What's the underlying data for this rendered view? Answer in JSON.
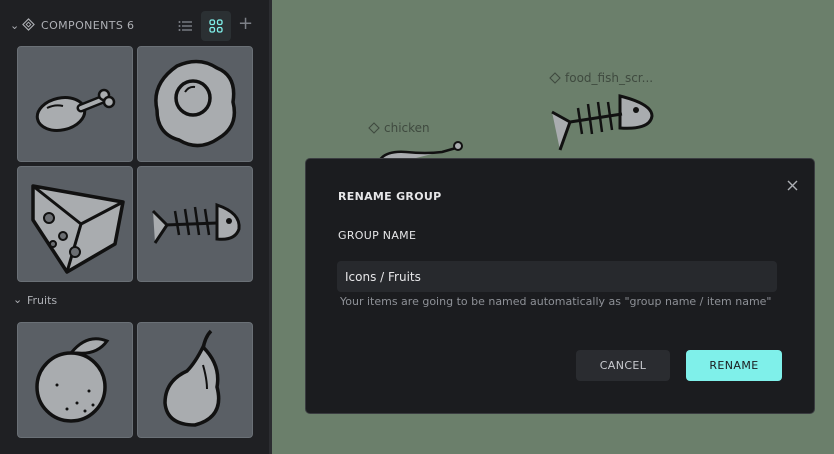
{
  "sidebar": {
    "title": "COMPONENTS",
    "count": "6",
    "group_name": "Fruits",
    "thumbnails": [
      "chicken",
      "food_fried_egg",
      "cheese",
      "food_fish_scraps",
      "orange",
      "pear"
    ]
  },
  "canvas": {
    "labels": {
      "chicken": "chicken",
      "fish": "food_fish_scr..."
    },
    "background": "#6b7f6b"
  },
  "dialog": {
    "title": "RENAME GROUP",
    "field_label": "GROUP NAME",
    "input_value": "Icons / Fruits",
    "hint": "Your items are going to be named automatically as \"group name / item name\"",
    "cancel_label": "CANCEL",
    "rename_label": "RENAME",
    "accent": "#7ff0ea"
  }
}
